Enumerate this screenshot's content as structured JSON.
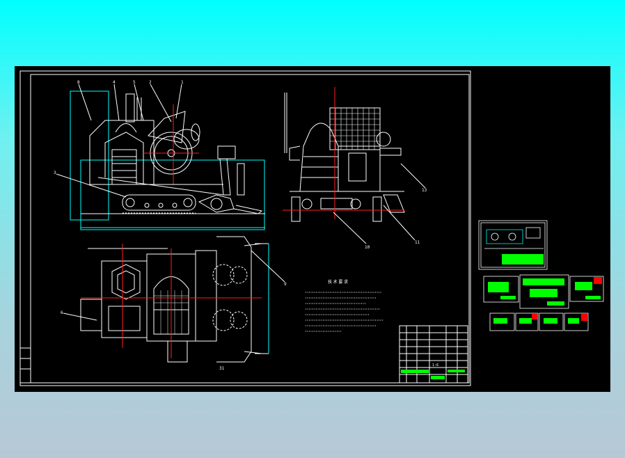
{
  "colors": {
    "background_top": "#00ffff",
    "background_bottom": "#b7c8d6",
    "canvas": "#000000",
    "line": "#ffffff",
    "cyan_line": "#00ffff",
    "center_line": "#ff2020",
    "green": "#00ff00",
    "red_fill": "#ff0000"
  },
  "side_view": {
    "callouts": [
      "8",
      "4",
      "5",
      "2",
      "1",
      "3"
    ]
  },
  "front_view": {
    "callouts": [
      "13",
      "10",
      "11"
    ]
  },
  "top_view": {
    "callouts": [
      "6",
      "9",
      "31"
    ]
  },
  "notes": {
    "title": "技 术 要 求"
  },
  "title_block": {
    "sheet_label": "1:6"
  },
  "thumbnails": [
    {
      "name": "thumb-assembly"
    },
    {
      "name": "thumb-part-a"
    },
    {
      "name": "thumb-part-b"
    },
    {
      "name": "thumb-part-c"
    },
    {
      "name": "thumb-part-d"
    },
    {
      "name": "thumb-part-e"
    },
    {
      "name": "thumb-part-f"
    },
    {
      "name": "thumb-part-g"
    }
  ]
}
